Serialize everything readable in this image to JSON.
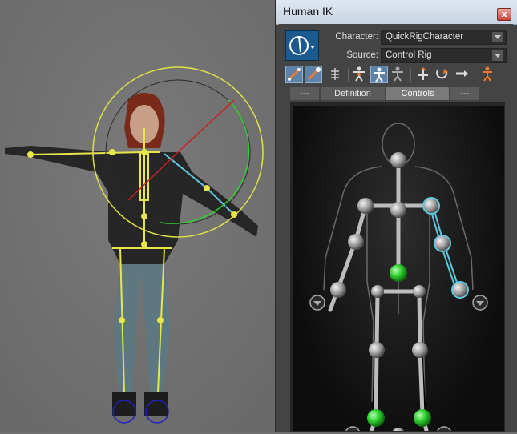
{
  "window": {
    "title": "Human IK",
    "close_label": "x"
  },
  "character": {
    "label": "Character:",
    "value": "QuickRigCharacter"
  },
  "source": {
    "label": "Source:",
    "value": "Control Rig"
  },
  "toolbar": {
    "icons": [
      "fk-pin-icon",
      "ik-pin-icon",
      "full-body-icon",
      "body-part-icon",
      "selection-icon",
      "pinning-icon",
      "stiffness-icon",
      "align-icon",
      "release-icon",
      "reach-icon"
    ]
  },
  "tabs": [
    {
      "label": "---",
      "active": false
    },
    {
      "label": "Definition",
      "active": false
    },
    {
      "label": "Controls",
      "active": true
    },
    {
      "label": "---",
      "active": false
    }
  ],
  "colors": {
    "accent": "#5d83a8",
    "effector_selected": "#5ec8e0",
    "effector_green": "#2fd12f"
  }
}
